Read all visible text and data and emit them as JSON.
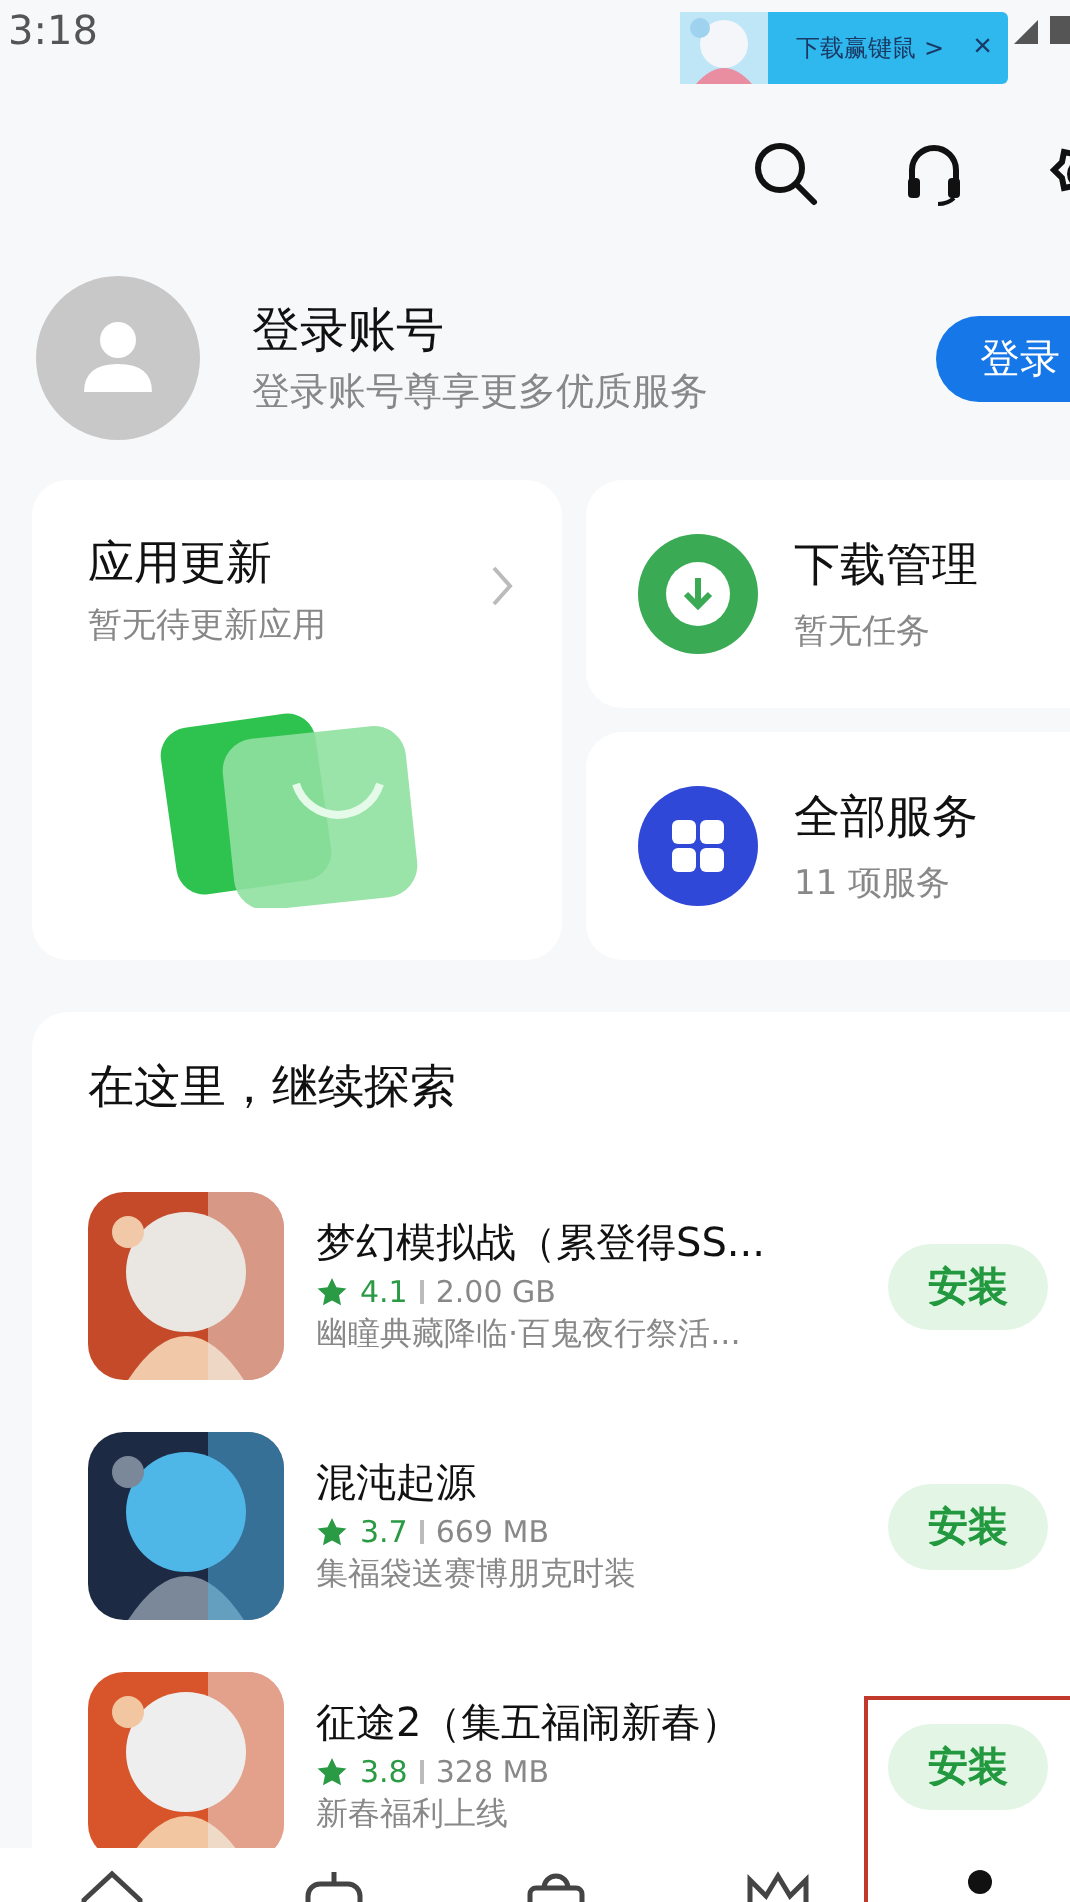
{
  "status_bar": {
    "time": "3:18"
  },
  "notification": {
    "text": "下载赢键鼠",
    "arrow": ">",
    "close": "×"
  },
  "account": {
    "title": "登录账号",
    "subtitle": "登录账号尊享更多优质服务",
    "button": "登录"
  },
  "cards": [
    {
      "kind": "update",
      "title": "应用更新",
      "subtitle": "暂无待更新应用"
    },
    {
      "kind": "download",
      "title": "下载管理",
      "subtitle": "暂无任务"
    },
    {
      "kind": "services",
      "title": "全部服务",
      "subtitle": "11 项服务"
    }
  ],
  "explore": {
    "title": "在这里，继续探索",
    "apps": [
      {
        "name": "梦幻模拟战（累登得SS...",
        "rating": "4.1",
        "size": "2.00 GB",
        "description": "幽瞳典藏降临·百鬼夜行祭活...",
        "button": "安装"
      },
      {
        "name": "混沌起源",
        "rating": "3.7",
        "size": "669 MB",
        "description": "集福袋送赛博朋克时装",
        "button": "安装"
      },
      {
        "name": "征途2（集五福闹新春）",
        "rating": "3.8",
        "size": "328 MB",
        "description": "新春福利上线",
        "button": "安装"
      }
    ]
  }
}
